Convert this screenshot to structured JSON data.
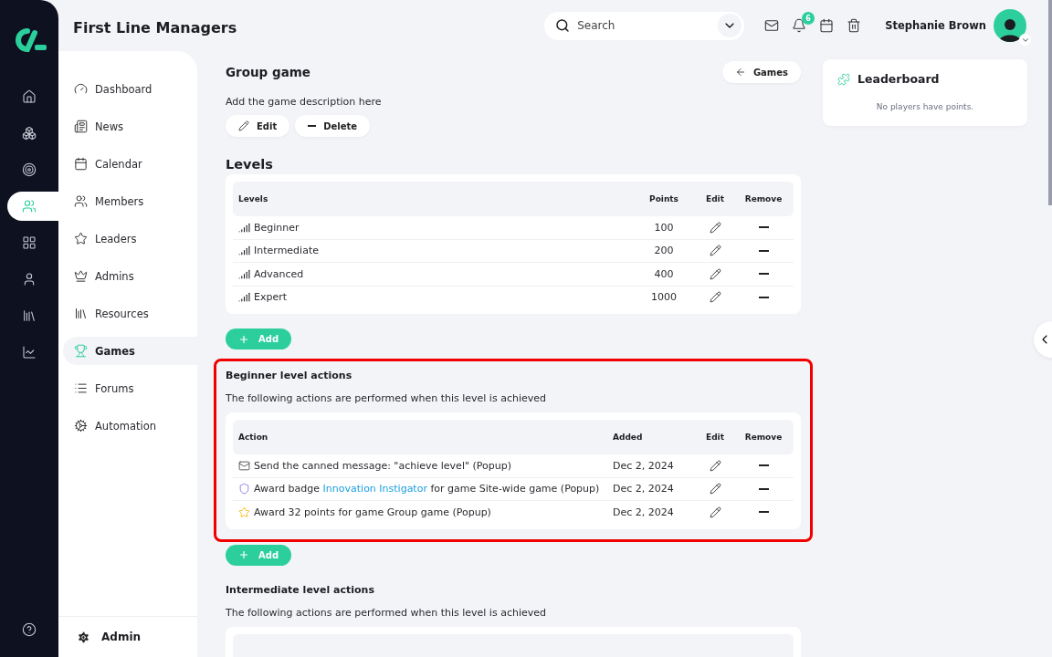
{
  "header": {
    "title": "First Line Managers",
    "search": {
      "placeholder": "Search"
    },
    "notification_count": "6",
    "user_name": "Stephanie Brown"
  },
  "rail": {
    "items": [
      {
        "selected": false
      },
      {
        "selected": false
      },
      {
        "selected": false
      },
      {
        "selected": true
      },
      {
        "selected": false
      },
      {
        "selected": false
      },
      {
        "selected": false
      },
      {
        "selected": false
      }
    ]
  },
  "nav": {
    "items": [
      {
        "label": "Dashboard",
        "selected": false
      },
      {
        "label": "News",
        "selected": false
      },
      {
        "label": "Calendar",
        "selected": false
      },
      {
        "label": "Members",
        "selected": false
      },
      {
        "label": "Leaders",
        "selected": false
      },
      {
        "label": "Admins",
        "selected": false
      },
      {
        "label": "Resources",
        "selected": false
      },
      {
        "label": "Games",
        "selected": true
      },
      {
        "label": "Forums",
        "selected": false
      },
      {
        "label": "Automation",
        "selected": false
      }
    ],
    "footer": "Admin"
  },
  "game": {
    "title": "Group game",
    "back_button": "Games",
    "description": "Add the game description here",
    "buttons": [
      {
        "kind": "edit",
        "label": "Edit"
      },
      {
        "kind": "delete",
        "label": "Delete"
      }
    ]
  },
  "levels": {
    "heading": "Levels",
    "columns": [
      "Levels",
      "Points",
      "Edit",
      "Remove"
    ],
    "rows": [
      {
        "name": "Beginner",
        "points": "100"
      },
      {
        "name": "Intermediate",
        "points": "200"
      },
      {
        "name": "Advanced",
        "points": "400"
      },
      {
        "name": "Expert",
        "points": "1000"
      }
    ],
    "add_button": "Add"
  },
  "level_actions": [
    {
      "title": "Beginner level actions",
      "description": "The following actions are performed when this level is achieved",
      "highlighted": true,
      "columns": [
        "Action",
        "Added",
        "Edit",
        "Remove"
      ],
      "rows": [
        {
          "kind": "message",
          "text": "Send the canned message: \"achieve level\" (Popup)",
          "added": "Dec 2, 2024"
        },
        {
          "kind": "badge",
          "text": "Award badge",
          "link": "Innovation Instigator",
          "text_after": "for game Site-wide game (Popup)",
          "added": "Dec 2, 2024"
        },
        {
          "kind": "points",
          "text": "Award 32 points for game Group game (Popup)",
          "added": "Dec 2, 2024"
        }
      ],
      "add_button": "Add"
    },
    {
      "title": "Intermediate level actions",
      "description": "The following actions are performed when this level is achieved",
      "highlighted": false
    }
  ],
  "leaderboard": {
    "title": "Leaderboard",
    "empty_text": "No players have points."
  }
}
